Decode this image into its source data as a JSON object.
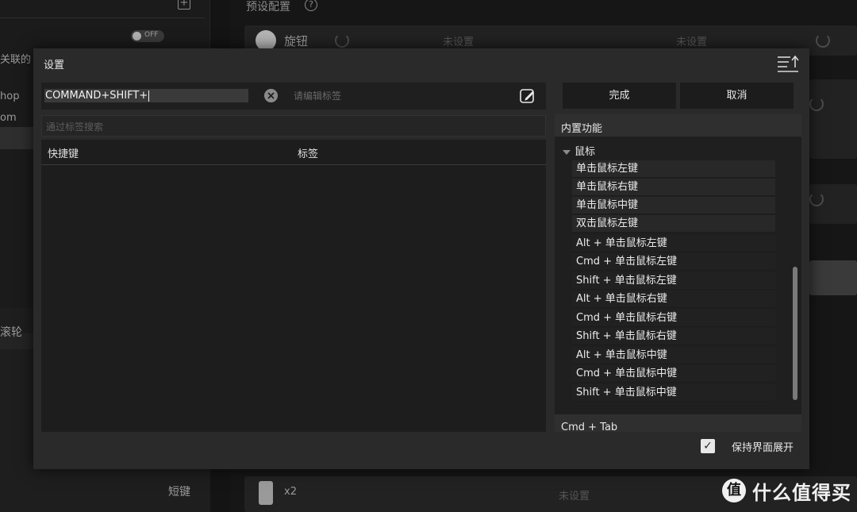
{
  "background": {
    "toggle_label": "OFF",
    "left_texts": {
      "associated": "关联的",
      "row1": "hop",
      "row2": "om",
      "scroll_wheel": "滚轮",
      "short_key": "短键"
    },
    "preset_title": "预设配置",
    "help_glyph": "?",
    "knob_label": "旋钮",
    "not_set_1": "未设置",
    "not_set_2": "未设置",
    "not_set_3": "未设置",
    "multiplier": "x2"
  },
  "modal": {
    "title": "设置",
    "shortcut_value": "COMMAND+SHIFT+",
    "tag_placeholder": "请编辑标签",
    "search_placeholder": "通过标签搜索",
    "columns": [
      "快捷键",
      "标签"
    ],
    "done_label": "完成",
    "cancel_label": "取消",
    "builtin": {
      "title": "内置功能",
      "group": "鼠标",
      "items": [
        "单击鼠标左键",
        "单击鼠标右键",
        "单击鼠标中键",
        "双击鼠标左键",
        "Alt + 单击鼠标左键",
        "Cmd + 单击鼠标左键",
        "Shift + 单击鼠标左键",
        "Alt + 单击鼠标右键",
        "Cmd + 单击鼠标右键",
        "Shift + 单击鼠标右键",
        "Alt + 单击鼠标中键",
        "Cmd + 单击鼠标中键",
        "Shift + 单击鼠标中键"
      ],
      "next_item": "Cmd + Tab"
    },
    "keep_expanded_label": "保持界面展开",
    "keep_expanded_checked": true
  },
  "watermark": {
    "logo": "值",
    "text": "什么值得买"
  }
}
